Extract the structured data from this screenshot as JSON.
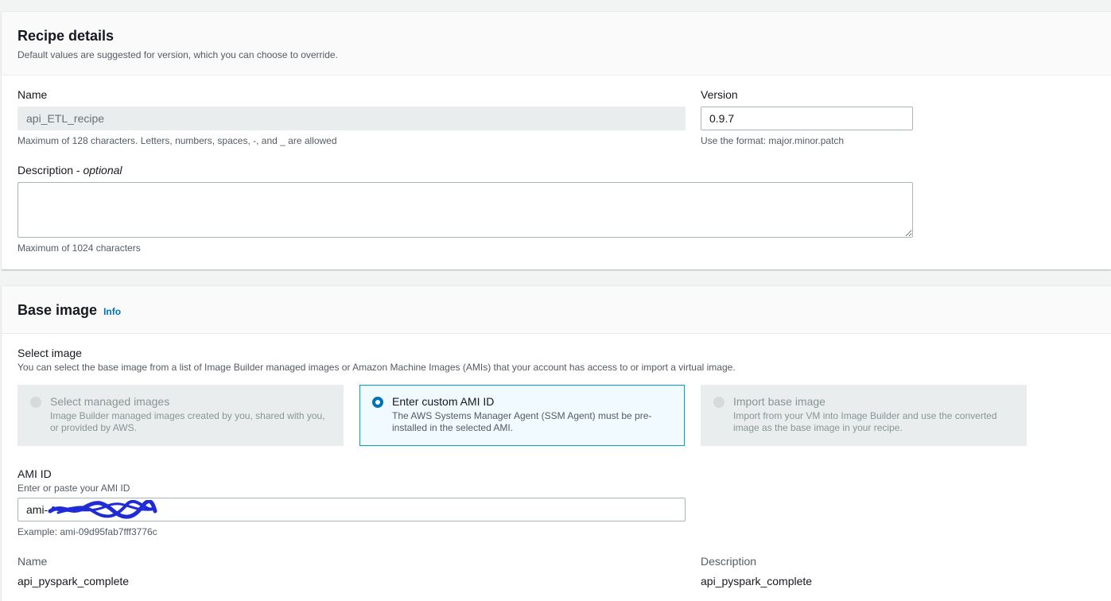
{
  "recipe_details": {
    "title": "Recipe details",
    "subtitle": "Default values are suggested for version, which you can choose to override.",
    "name_label": "Name",
    "name_value": "api_ETL_recipe",
    "name_hint": "Maximum of 128 characters. Letters, numbers, spaces, -, and _ are allowed",
    "version_label": "Version",
    "version_value": "0.9.7",
    "version_hint": "Use the format: major.minor.patch",
    "description_label": "Description",
    "description_optional": "optional",
    "description_separator": " - ",
    "description_value": "",
    "description_hint": "Maximum of 1024 characters"
  },
  "base_image": {
    "title": "Base image",
    "info_link": "Info",
    "select_label": "Select image",
    "select_hint": "You can select the base image from a list of Image Builder managed images or Amazon Machine Images (AMIs) that your account has access to or import a virtual image.",
    "options": [
      {
        "title": "Select managed images",
        "description": "Image Builder managed images created by you, shared with you, or provided by AWS.",
        "selected": false
      },
      {
        "title": "Enter custom AMI ID",
        "description": "The AWS Systems Manager Agent (SSM Agent) must be pre-installed in the selected AMI.",
        "selected": true
      },
      {
        "title": "Import base image",
        "description": "Import from your VM into Image Builder and use the converted image as the base image in your recipe.",
        "selected": false
      }
    ],
    "ami_label": "AMI ID",
    "ami_hint": "Enter or paste your AMI ID",
    "ami_value_prefix": "ami-",
    "ami_example": "Example: ami-09d95fab7fff3776c",
    "image_name_label": "Name",
    "image_name_value": "api_pyspark_complete",
    "image_description_label": "Description",
    "image_description_value": "api_pyspark_complete"
  },
  "colors": {
    "accent": "#0073bb",
    "selected_border": "#00a1c9",
    "redaction": "#1f2bd6"
  }
}
